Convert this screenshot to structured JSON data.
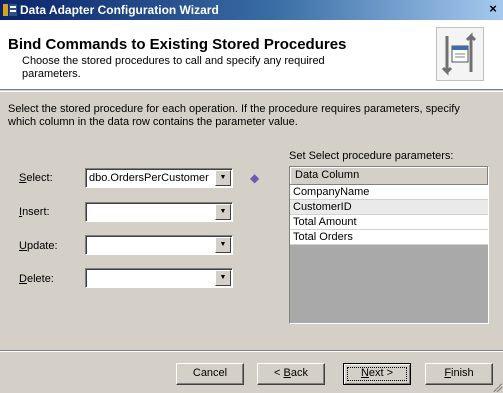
{
  "window": {
    "title": "Data Adapter Configuration Wizard",
    "close_glyph": "×"
  },
  "header": {
    "title": "Bind Commands to Existing Stored Procedures",
    "subtitle": "Choose the stored procedures to call and specify any required parameters.",
    "icon": "stored-procedure-wizard-icon"
  },
  "description": "Select the stored procedure for each operation. If the procedure requires parameters, specify which column in the data row contains the parameter value.",
  "fields": [
    {
      "key": "S",
      "rest": "elect:",
      "value": ""
    },
    {
      "key": "I",
      "rest": "nsert:",
      "value": ""
    },
    {
      "key": "U",
      "rest": "pdate:",
      "value": ""
    },
    {
      "key": "D",
      "rest": "elete:",
      "value": ""
    }
  ],
  "select_value": "dbo.OrdersPerCustomer",
  "params": {
    "caption": "Set Select procedure parameters:",
    "column_header": "Data Column",
    "rows": [
      "CompanyName",
      "CustomerID",
      "Total Amount",
      "Total Orders"
    ]
  },
  "buttons": {
    "cancel": "Cancel",
    "back_prefix": "< ",
    "back_key": "B",
    "back_rest": "ack",
    "next_key": "N",
    "next_rest": "ext >",
    "finish_key": "F",
    "finish_rest": "inish"
  },
  "colors": {
    "title_start": "#0a246a",
    "title_end": "#a6caf0",
    "dialog_bg": "#d4d0c8",
    "grid_bg": "#a9a9a9",
    "arrow": "#6b5bb5"
  }
}
